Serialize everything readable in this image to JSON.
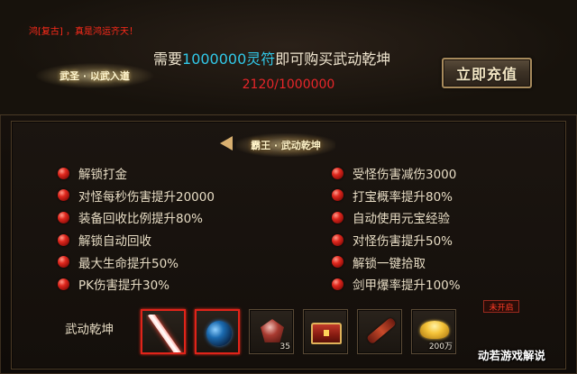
{
  "header": {
    "marquee": "鸿[复古] ，真是鸿运齐天！",
    "realm_badge": "武圣 · 以武入道",
    "purchase_prefix": "需要",
    "purchase_amount": "1000000灵符",
    "purchase_suffix": "即可购买武动乾坤",
    "progress": "2120/1000000",
    "recharge_button": "立即充值"
  },
  "panel": {
    "title_badge": "霸王 · 武动乾坤",
    "perks_left": [
      "解锁打金",
      "对怪每秒伤害提升20000",
      "装备回收比例提升80%",
      "解锁自动回收",
      "最大生命提升50%",
      "PK伤害提升30%"
    ],
    "perks_right": [
      "受怪伤害减伤3000",
      "打宝概率提升80%",
      "自动使用元宝经验",
      "对怪伤害提升50%",
      "解锁一键拾取",
      "剑甲爆率提升100%"
    ],
    "item_row_label": "武动乾坤",
    "items": [
      {
        "icon": "sword-icon",
        "qty": ""
      },
      {
        "icon": "orb-icon",
        "qty": ""
      },
      {
        "icon": "gem-icon",
        "qty": "35"
      },
      {
        "icon": "chest-icon",
        "qty": ""
      },
      {
        "icon": "scroll-icon",
        "qty": ""
      },
      {
        "icon": "gold-ingot-icon",
        "qty": "200万"
      }
    ],
    "status": "未开启"
  },
  "watermark": "动若游戏解说",
  "colors": {
    "accent_cyan": "#31c8e8",
    "progress_red": "#e8262a",
    "bullet_red": "#e0281e"
  }
}
